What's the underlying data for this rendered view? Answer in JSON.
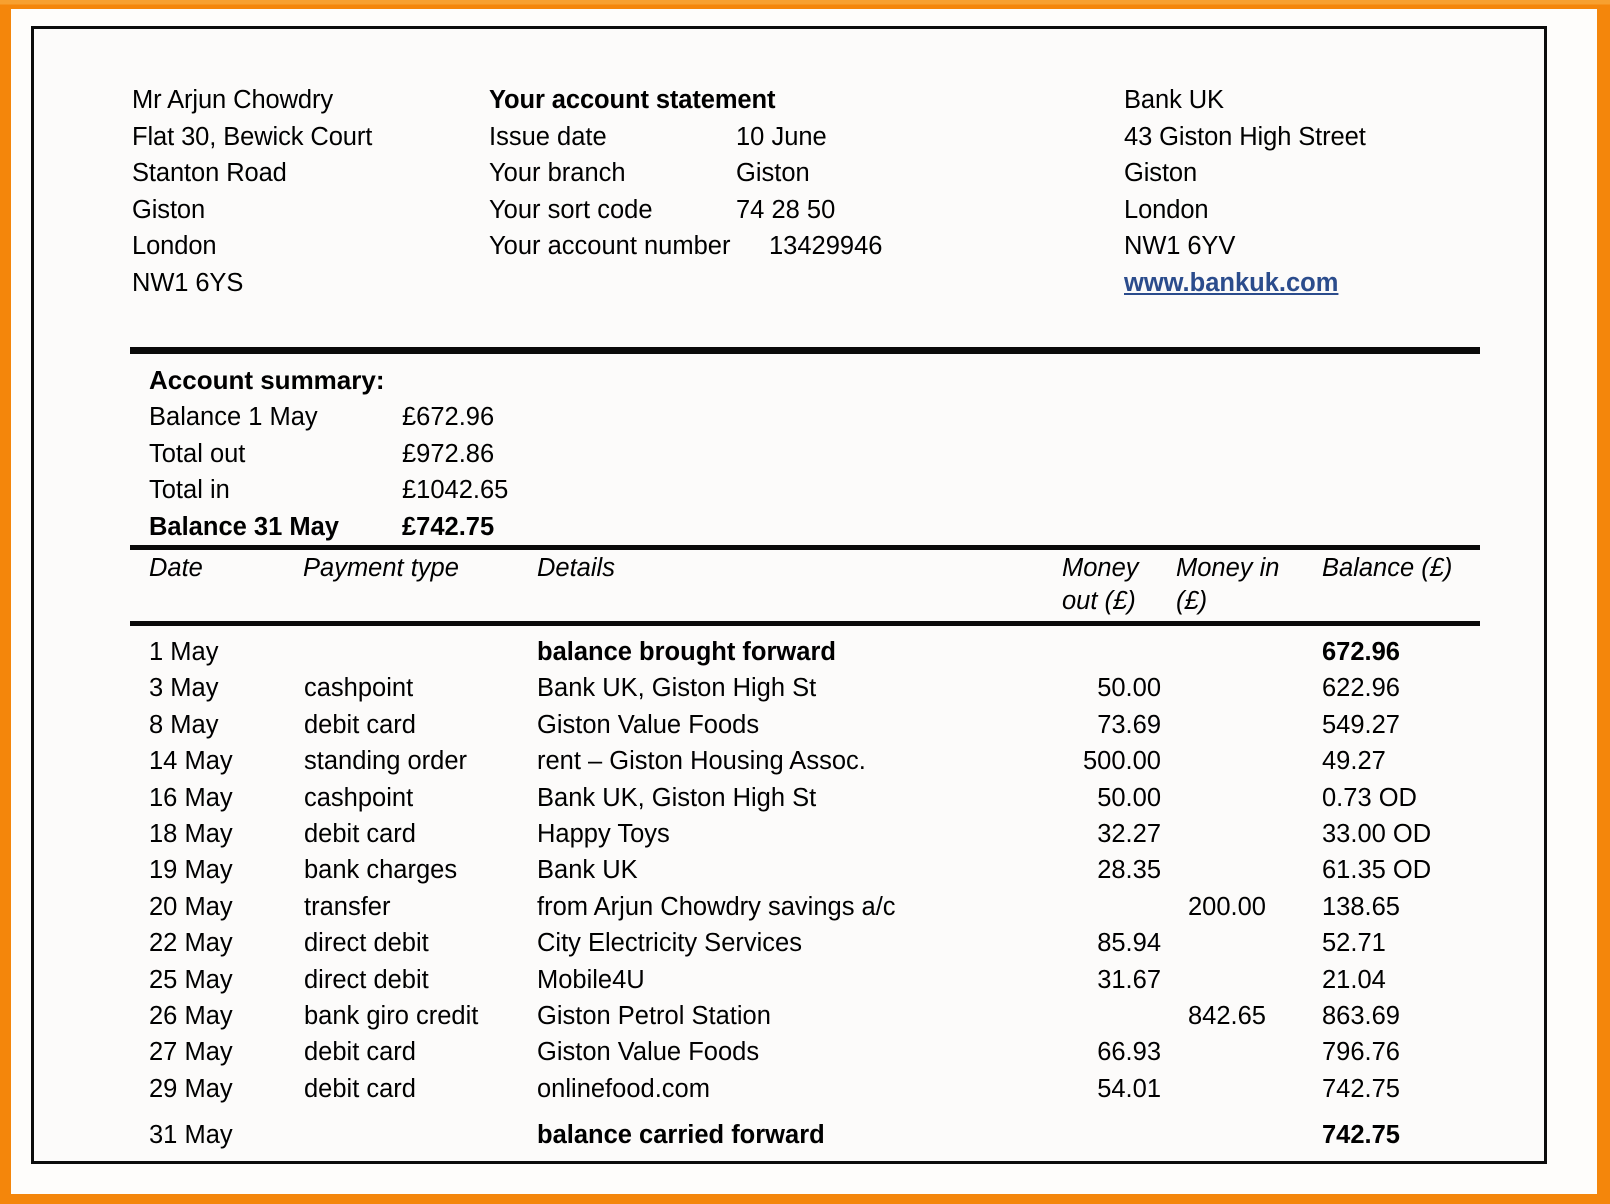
{
  "colors": {
    "frame_orange": "#F4860B",
    "frame_orange_light": "#F7A030",
    "link_blue": "#2B4C8C",
    "rule_black": "#0a0a0a",
    "paper": "#FCFBFA"
  },
  "customer": {
    "name": "Mr Arjun Chowdry",
    "address_lines": [
      "Flat 30, Bewick Court",
      "Stanton Road",
      "Giston",
      "London",
      "NW1 6YS"
    ]
  },
  "statement": {
    "title": "Your account statement",
    "fields": [
      {
        "label": "Issue date",
        "value": "10 June"
      },
      {
        "label": "Your branch",
        "value": "Giston"
      },
      {
        "label": "Your sort code",
        "value": "74 28 50"
      },
      {
        "label": "Your account number",
        "value": "13429946"
      }
    ]
  },
  "bank": {
    "name": "Bank UK",
    "address_lines": [
      "43 Giston High Street",
      "Giston",
      "London",
      "NW1 6YV"
    ],
    "website": "www.bankuk.com"
  },
  "account_summary": {
    "heading": "Account summary:",
    "rows": [
      {
        "label": "Balance 1 May",
        "value": "£672.96",
        "bold": false
      },
      {
        "label": "Total out",
        "value": "£972.86",
        "bold": false
      },
      {
        "label": "Total in",
        "value": "£1042.65",
        "bold": false
      },
      {
        "label": "Balance 31 May",
        "value": "£742.75",
        "bold": true
      }
    ]
  },
  "transactions": {
    "headers": {
      "date": "Date",
      "payment_type": "Payment type",
      "details": "Details",
      "money_out": "Money out (£)",
      "money_in": "Money in (£)",
      "balance": "Balance (£)"
    },
    "rows": [
      {
        "date": "1 May",
        "type": "",
        "details": "balance brought forward",
        "out": "",
        "in": "",
        "balance": "672.96",
        "bold": true
      },
      {
        "date": "3 May",
        "type": "cashpoint",
        "details": "Bank UK, Giston High St",
        "out": "50.00",
        "in": "",
        "balance": "622.96",
        "bold": false
      },
      {
        "date": "8 May",
        "type": "debit card",
        "details": "Giston Value Foods",
        "out": "73.69",
        "in": "",
        "balance": "549.27",
        "bold": false
      },
      {
        "date": "14 May",
        "type": "standing order",
        "details": "rent – Giston Housing Assoc.",
        "out": "500.00",
        "in": "",
        "balance": "49.27",
        "bold": false
      },
      {
        "date": "16 May",
        "type": "cashpoint",
        "details": "Bank UK, Giston High St",
        "out": "50.00",
        "in": "",
        "balance": "0.73 OD",
        "bold": false
      },
      {
        "date": "18 May",
        "type": "debit card",
        "details": "Happy Toys",
        "out": "32.27",
        "in": "",
        "balance": "33.00 OD",
        "bold": false
      },
      {
        "date": "19 May",
        "type": "bank charges",
        "details": "Bank UK",
        "out": "28.35",
        "in": "",
        "balance": "61.35 OD",
        "bold": false
      },
      {
        "date": "20 May",
        "type": "transfer",
        "details": "from Arjun Chowdry savings a/c",
        "out": "",
        "in": "200.00",
        "balance": "138.65",
        "bold": false
      },
      {
        "date": "22 May",
        "type": "direct debit",
        "details": "City Electricity Services",
        "out": "85.94",
        "in": "",
        "balance": "52.71",
        "bold": false
      },
      {
        "date": "25 May",
        "type": "direct debit",
        "details": "Mobile4U",
        "out": "31.67",
        "in": "",
        "balance": "21.04",
        "bold": false
      },
      {
        "date": "26 May",
        "type": "bank giro credit",
        "details": "Giston Petrol Station",
        "out": "",
        "in": "842.65",
        "balance": "863.69",
        "bold": false
      },
      {
        "date": "27 May",
        "type": "debit card",
        "details": "Giston Value Foods",
        "out": "66.93",
        "in": "",
        "balance": "796.76",
        "bold": false
      },
      {
        "date": "29 May",
        "type": "debit card",
        "details": "onlinefood.com",
        "out": "54.01",
        "in": "",
        "balance": "742.75",
        "bold": false
      },
      {
        "date": "31 May",
        "type": "",
        "details": "balance carried forward",
        "out": "",
        "in": "",
        "balance": "742.75",
        "bold": true
      }
    ]
  }
}
